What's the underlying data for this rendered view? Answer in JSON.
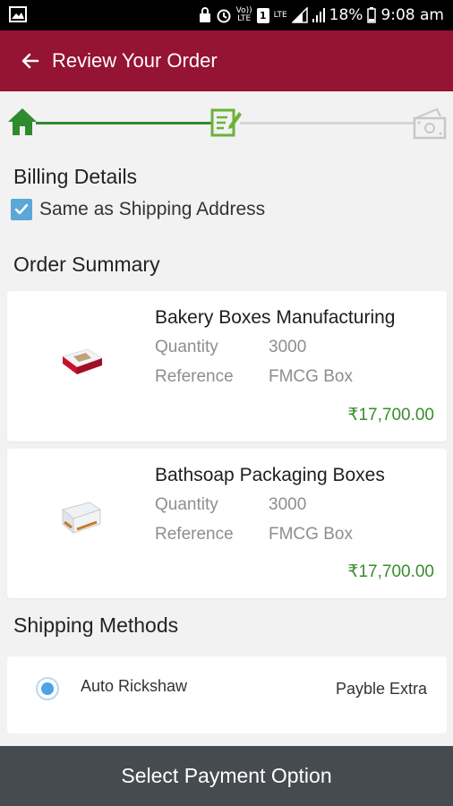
{
  "status_bar": {
    "battery": "18%",
    "time": "9:08 am",
    "net_vo_label": "Vo))",
    "net_lte_label": "LTE",
    "sim_indicator": "1",
    "lte2_label": "LTE"
  },
  "app_bar": {
    "title": "Review Your Order"
  },
  "stepper": {
    "steps": [
      "home-icon",
      "edit-document-icon",
      "money-icon"
    ],
    "current_step": 2
  },
  "billing": {
    "title": "Billing Details",
    "same_as_shipping_label": "Same as Shipping Address",
    "same_as_shipping_checked": true
  },
  "order_summary": {
    "title": "Order Summary",
    "items": [
      {
        "name": "Bakery Boxes Manufacturing",
        "quantity_label": "Quantity",
        "quantity": "3000",
        "reference_label": "Reference",
        "reference": "FMCG Box",
        "price": "₹17,700.00"
      },
      {
        "name": "Bathsoap Packaging Boxes",
        "quantity_label": "Quantity",
        "quantity": "3000",
        "reference_label": "Reference",
        "reference": "FMCG Box",
        "price": "₹17,700.00"
      }
    ]
  },
  "shipping": {
    "title": "Shipping Methods",
    "method": "Auto Rickshaw",
    "cost_note": "Payble Extra",
    "selected": true
  },
  "footer": {
    "button_label": "Select Payment Option"
  },
  "colors": {
    "app_bar": "#951333",
    "progress_done": "#2e8b2e",
    "price": "#3a8c2e",
    "footer": "#464b50",
    "radio": "#4aa4e6"
  }
}
